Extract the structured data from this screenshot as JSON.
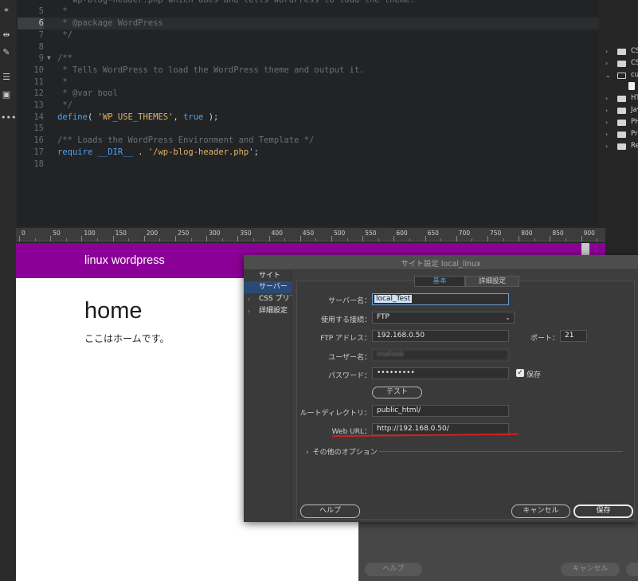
{
  "editor": {
    "current_line": "6",
    "lines": [
      {
        "n": "",
        "parts": [
          {
            "c": "c-cm",
            "t": " * wp-blog-header.php which does and tells WordPress to load the theme."
          }
        ]
      },
      {
        "n": "5",
        "parts": [
          {
            "c": "c-cm",
            "t": " *"
          }
        ]
      },
      {
        "n": "6",
        "parts": [
          {
            "c": "c-cm",
            "t": " * @package WordPress"
          }
        ]
      },
      {
        "n": "7",
        "parts": [
          {
            "c": "c-cm",
            "t": " */"
          }
        ]
      },
      {
        "n": "8",
        "parts": []
      },
      {
        "n": "9",
        "parts": [
          {
            "c": "c-cm",
            "t": "/**"
          }
        ]
      },
      {
        "n": "10",
        "parts": [
          {
            "c": "c-cm",
            "t": " * Tells WordPress to load the WordPress theme and output it."
          }
        ]
      },
      {
        "n": "11",
        "parts": [
          {
            "c": "c-cm",
            "t": " *"
          }
        ]
      },
      {
        "n": "12",
        "parts": [
          {
            "c": "c-cm",
            "t": " * @var bool"
          }
        ]
      },
      {
        "n": "13",
        "parts": [
          {
            "c": "c-cm",
            "t": " */"
          }
        ]
      },
      {
        "n": "14",
        "parts": [
          {
            "c": "c-kw",
            "t": "define"
          },
          {
            "c": "c-tx",
            "t": "( "
          },
          {
            "c": "c-str",
            "t": "'WP_USE_THEMES'"
          },
          {
            "c": "c-tx",
            "t": ", "
          },
          {
            "c": "c-kw",
            "t": "true"
          },
          {
            "c": "c-tx",
            "t": " );"
          }
        ]
      },
      {
        "n": "15",
        "parts": []
      },
      {
        "n": "16",
        "parts": [
          {
            "c": "c-cm",
            "t": "/** Loads the WordPress Environment and Template */"
          }
        ]
      },
      {
        "n": "17",
        "parts": [
          {
            "c": "c-kw",
            "t": "require"
          },
          {
            "c": "c-tx",
            "t": " "
          },
          {
            "c": "c-kw",
            "t": "__DIR__"
          },
          {
            "c": "c-tx",
            "t": " . "
          },
          {
            "c": "c-str",
            "t": "'/wp-blog-header.php'"
          },
          {
            "c": "c-tx",
            "t": ";"
          }
        ]
      },
      {
        "n": "18",
        "parts": []
      }
    ]
  },
  "filetree": {
    "items": [
      {
        "label": "CS",
        "icon": "folder-icon",
        "chev": "›"
      },
      {
        "label": "CS",
        "icon": "folder-icon",
        "chev": "›"
      },
      {
        "label": "cu",
        "icon": "folder-open-icon",
        "chev": "⌄"
      },
      {
        "label": "",
        "icon": "file-icon",
        "chev": ""
      },
      {
        "label": "HT",
        "icon": "folder-icon",
        "chev": "›"
      },
      {
        "label": "Jav",
        "icon": "folder-icon",
        "chev": "›"
      },
      {
        "label": "PH",
        "icon": "folder-icon",
        "chev": "›"
      },
      {
        "label": "Pr",
        "icon": "folder-icon",
        "chev": "›"
      },
      {
        "label": "Re",
        "icon": "folder-icon",
        "chev": "›"
      }
    ]
  },
  "ruler": {
    "labels": [
      "0",
      "50",
      "100",
      "150",
      "200",
      "250",
      "300",
      "350",
      "400",
      "450",
      "500",
      "550",
      "600",
      "650",
      "700",
      "750",
      "800",
      "850",
      "900"
    ]
  },
  "preview": {
    "site_title": "linux wordpress",
    "page_heading": "home",
    "page_body": "ここはホームです。"
  },
  "dialog": {
    "title": "サイト設定 local_linux",
    "sidebar": [
      {
        "label": "サイト",
        "arrow": ""
      },
      {
        "label": "サーバー",
        "arrow": ""
      },
      {
        "label": "CSS プリプロセッサー",
        "arrow": "›"
      },
      {
        "label": "詳細設定",
        "arrow": "›"
      }
    ],
    "tabs": {
      "basic": "基本",
      "advanced": "詳細設定"
    },
    "fields": {
      "server_name_label": "サーバー名：",
      "server_name_value": "local_Test",
      "connection_label": "使用する接続：",
      "connection_value": "FTP",
      "ftp_address_label": "FTP アドレス：",
      "ftp_address_value": "192.168.0.50",
      "port_label": "ポート：",
      "port_value": "21",
      "username_label": "ユーザー名：",
      "username_value": "mafoob",
      "password_label": "パスワード：",
      "password_value": "•••••••••",
      "save_checkbox_label": "保存",
      "test_button": "テスト",
      "root_dir_label": "ルートディレクトリ：",
      "root_dir_value": "public_html/",
      "web_url_label": "Web URL：",
      "web_url_value": "http://192.168.0.50/",
      "more_options": "その他のオプション"
    },
    "buttons": {
      "help": "ヘルプ",
      "cancel": "キャンセル",
      "save": "保存"
    }
  },
  "back_dialog": {
    "buttons": {
      "help": "ヘルプ",
      "cancel": "キャンセル"
    }
  }
}
